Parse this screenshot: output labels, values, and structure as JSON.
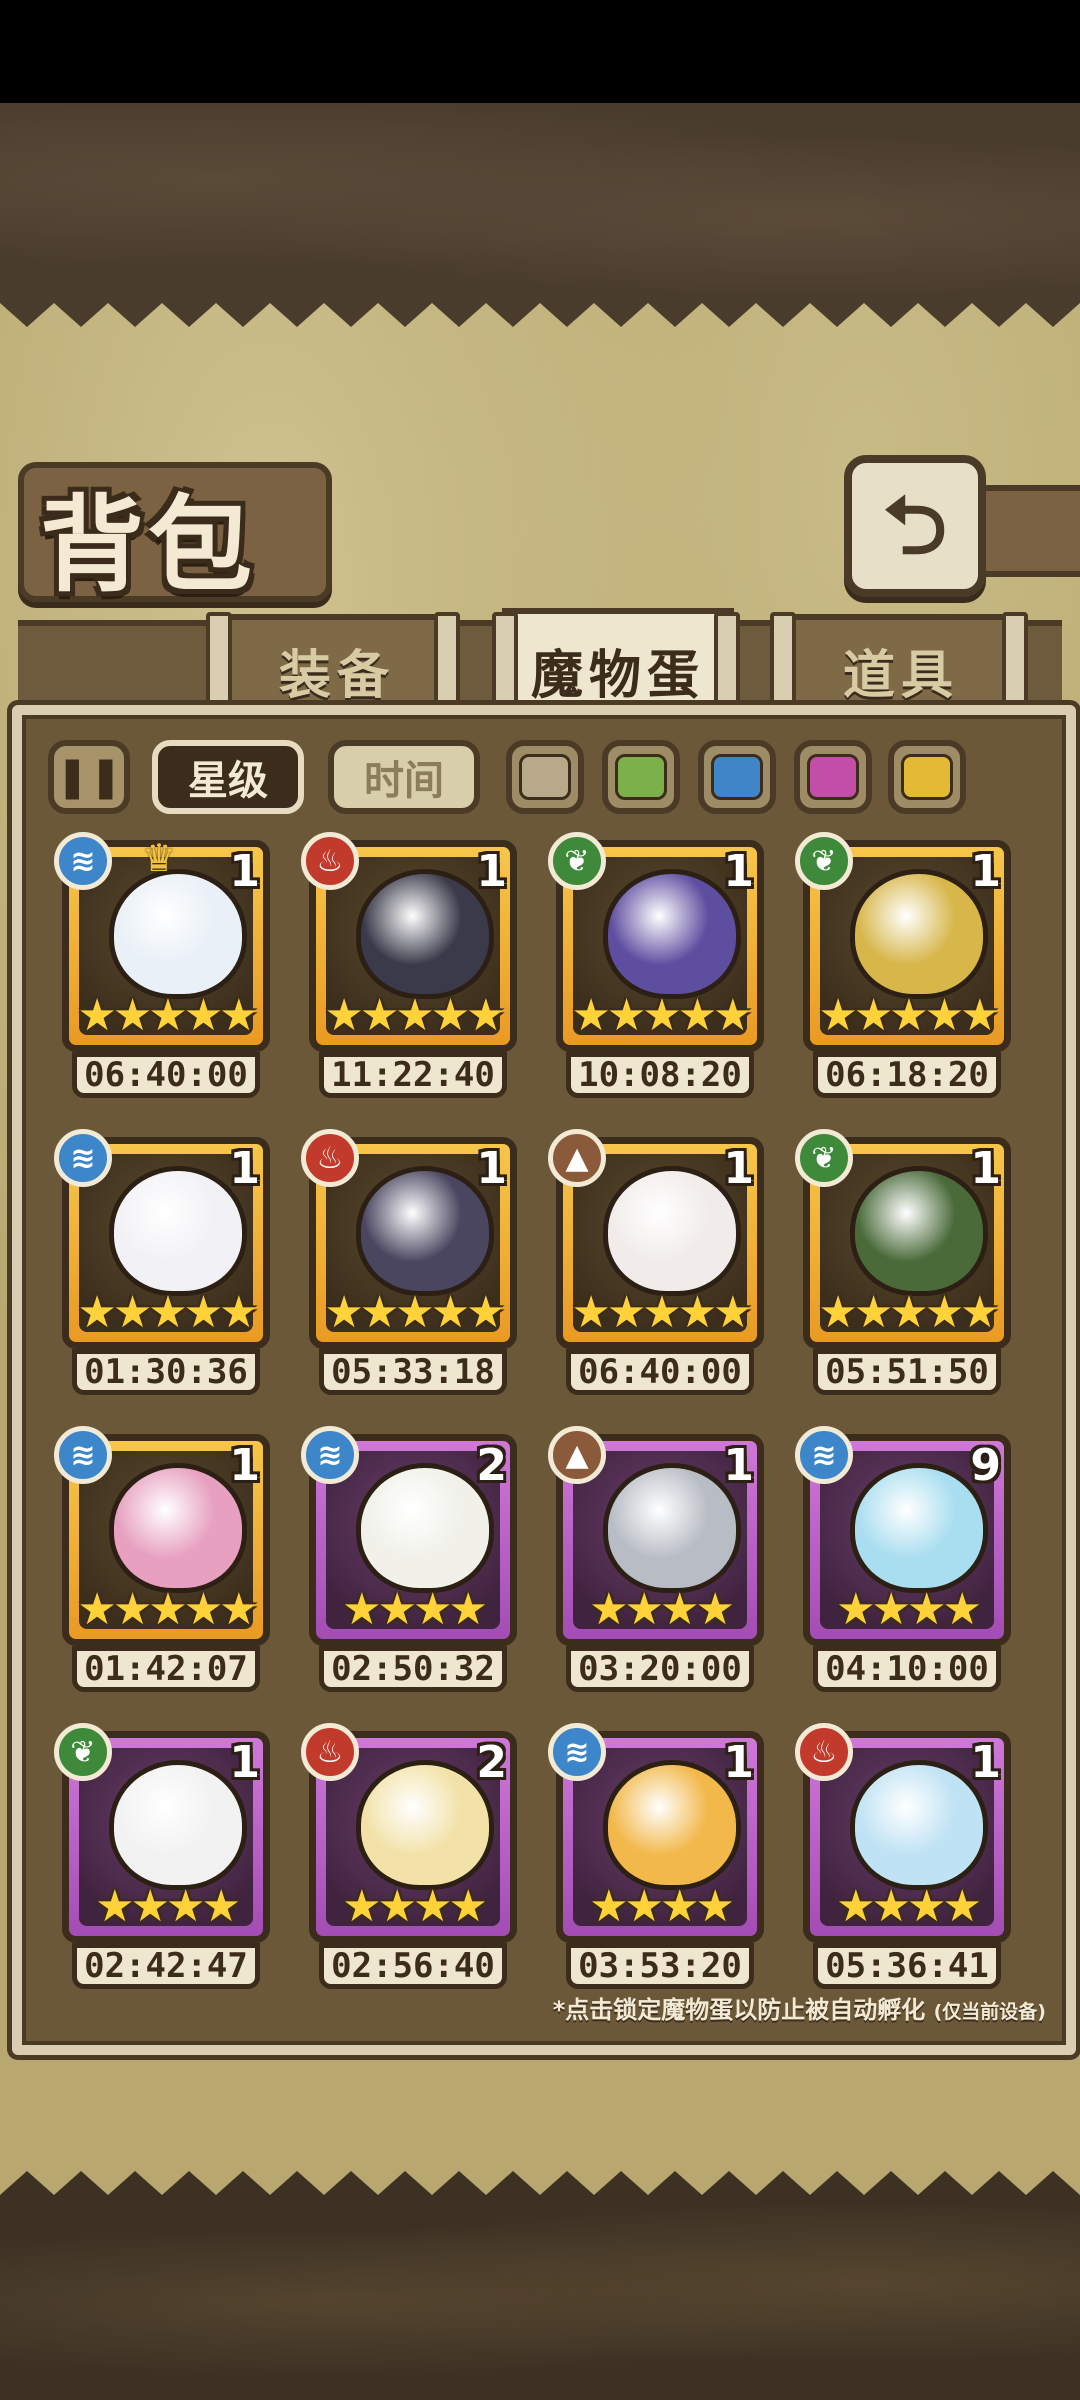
{
  "title": "背包",
  "tabs": [
    {
      "label": "装备",
      "active": false
    },
    {
      "label": "魔物蛋",
      "active": true
    },
    {
      "label": "道具",
      "active": false
    }
  ],
  "filters": {
    "star_label": "星级",
    "time_label": "时间",
    "colors": [
      "#b7a98a",
      "#7cb04a",
      "#3f86c8",
      "#c24ea8",
      "#e3b935"
    ]
  },
  "eggs": [
    {
      "element": "water",
      "count": "1",
      "frame": "gold",
      "stars": 5,
      "timer": "06:40:00",
      "crown": true,
      "art_color": "#e9f0f7"
    },
    {
      "element": "fire",
      "count": "1",
      "frame": "gold",
      "stars": 5,
      "timer": "11:22:40",
      "crown": false,
      "art_color": "#3a3a4a"
    },
    {
      "element": "nature",
      "count": "1",
      "frame": "gold",
      "stars": 5,
      "timer": "10:08:20",
      "crown": false,
      "art_color": "#5e4ea0"
    },
    {
      "element": "nature",
      "count": "1",
      "frame": "gold",
      "stars": 5,
      "timer": "06:18:20",
      "crown": false,
      "art_color": "#d7b64a"
    },
    {
      "element": "water",
      "count": "1",
      "frame": "gold",
      "stars": 5,
      "timer": "01:30:36",
      "crown": false,
      "art_color": "#f2f2f6"
    },
    {
      "element": "fire",
      "count": "1",
      "frame": "gold",
      "stars": 5,
      "timer": "05:33:18",
      "crown": false,
      "art_color": "#4a4660"
    },
    {
      "element": "earth",
      "count": "1",
      "frame": "gold",
      "stars": 5,
      "timer": "06:40:00",
      "crown": false,
      "art_color": "#f1ecea"
    },
    {
      "element": "nature",
      "count": "1",
      "frame": "gold",
      "stars": 5,
      "timer": "05:51:50",
      "crown": false,
      "art_color": "#4a6a3a"
    },
    {
      "element": "water",
      "count": "1",
      "frame": "gold",
      "stars": 5,
      "timer": "01:42:07",
      "crown": false,
      "art_color": "#e7a0c0"
    },
    {
      "element": "water",
      "count": "2",
      "frame": "purple",
      "stars": 4,
      "timer": "02:50:32",
      "crown": false,
      "art_color": "#f1f1ea"
    },
    {
      "element": "earth",
      "count": "1",
      "frame": "purple",
      "stars": 4,
      "timer": "03:20:00",
      "crown": false,
      "art_color": "#b8bcc4"
    },
    {
      "element": "water",
      "count": "9",
      "frame": "purple",
      "stars": 4,
      "timer": "04:10:00",
      "crown": false,
      "art_color": "#a9def0"
    },
    {
      "element": "nature",
      "count": "1",
      "frame": "purple",
      "stars": 4,
      "timer": "02:42:47",
      "crown": false,
      "art_color": "#f2f2f2"
    },
    {
      "element": "fire",
      "count": "2",
      "frame": "purple",
      "stars": 4,
      "timer": "02:56:40",
      "crown": false,
      "art_color": "#f2e2a8"
    },
    {
      "element": "water",
      "count": "1",
      "frame": "purple",
      "stars": 4,
      "timer": "03:53:20",
      "crown": false,
      "art_color": "#f2b84a"
    },
    {
      "element": "fire",
      "count": "1",
      "frame": "purple",
      "stars": 4,
      "timer": "05:36:41",
      "crown": false,
      "art_color": "#bfe2f4"
    }
  ],
  "footnote": {
    "main": "*点击锁定魔物蛋以防止被自动孵化",
    "small": "(仅当前设备)"
  }
}
